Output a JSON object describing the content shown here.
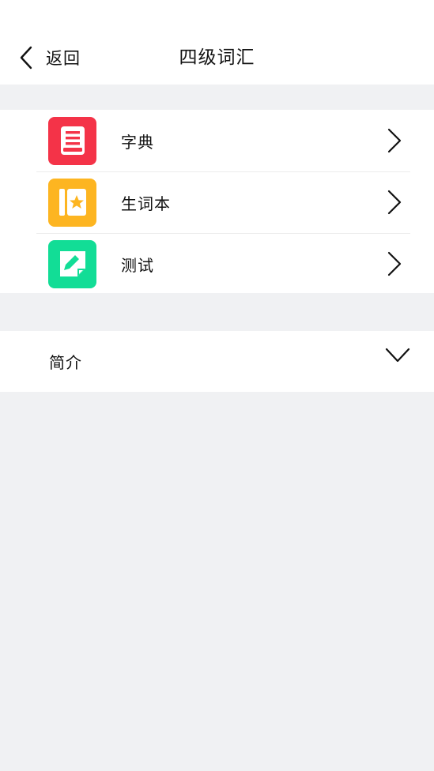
{
  "header": {
    "back_label": "返回",
    "title": "四级词汇"
  },
  "menu": {
    "items": [
      {
        "label": "字典",
        "icon": "dictionary-book-icon",
        "color": "#f43348"
      },
      {
        "label": "生词本",
        "icon": "starred-notebook-icon",
        "color": "#fdb521"
      },
      {
        "label": "测试",
        "icon": "edit-pencil-icon",
        "color": "#12dd96"
      }
    ]
  },
  "intro": {
    "label": "简介",
    "icon": "chevron-down-icon"
  },
  "colors": {
    "background": "#f0f1f3",
    "surface": "#ffffff"
  }
}
